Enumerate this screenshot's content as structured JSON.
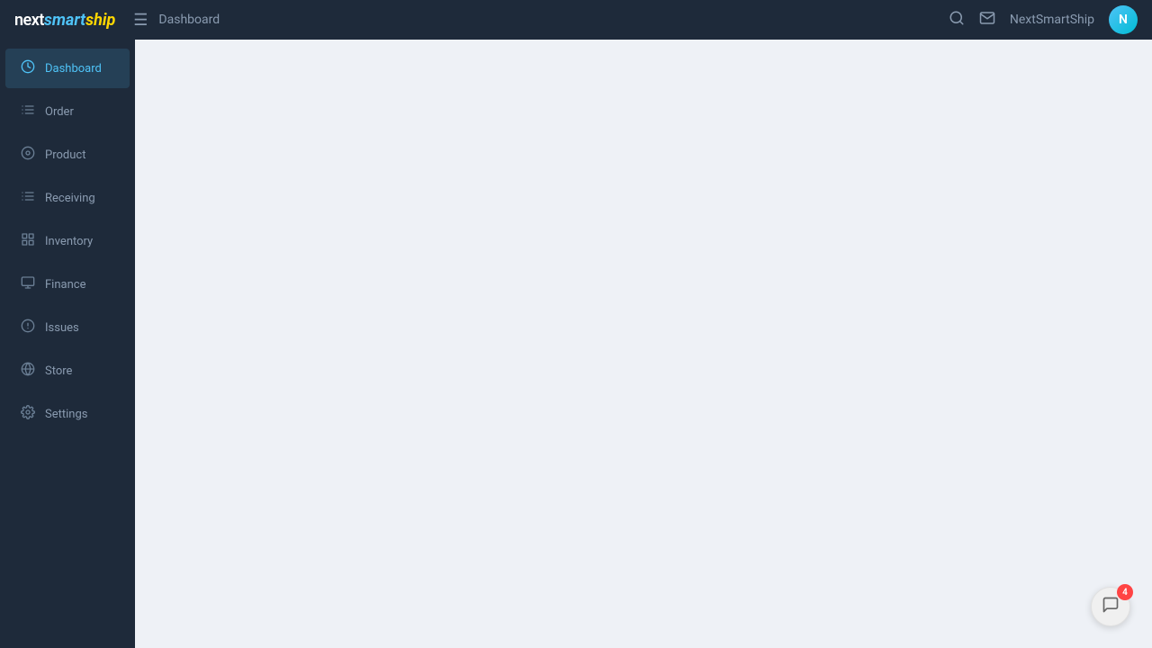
{
  "header": {
    "logo": {
      "next": "next",
      "smart": "smart",
      "ship": "ship"
    },
    "breadcrumb": "Dashboard",
    "user_name": "NextSmartShip",
    "avatar_initials": "N",
    "hamburger_unicode": "☰",
    "search_unicode": "🔍",
    "mail_unicode": "✉"
  },
  "sidebar": {
    "items": [
      {
        "id": "dashboard",
        "label": "Dashboard",
        "active": true,
        "icon": "dashboard"
      },
      {
        "id": "order",
        "label": "Order",
        "active": false,
        "icon": "order"
      },
      {
        "id": "product",
        "label": "Product",
        "active": false,
        "icon": "product"
      },
      {
        "id": "receiving",
        "label": "Receiving",
        "active": false,
        "icon": "receiving"
      },
      {
        "id": "inventory",
        "label": "Inventory",
        "active": false,
        "icon": "inventory"
      },
      {
        "id": "finance",
        "label": "Finance",
        "active": false,
        "icon": "finance"
      },
      {
        "id": "issues",
        "label": "Issues",
        "active": false,
        "icon": "issues"
      },
      {
        "id": "store",
        "label": "Store",
        "active": false,
        "icon": "store"
      },
      {
        "id": "settings",
        "label": "Settings",
        "active": false,
        "icon": "settings"
      }
    ]
  },
  "chat": {
    "badge_count": "4",
    "icon": "💬"
  }
}
